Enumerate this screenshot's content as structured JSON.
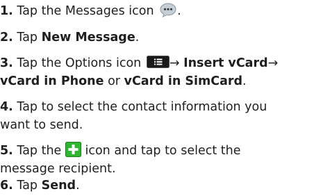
{
  "steps": [
    {
      "number": "1.",
      "text_before": "Tap the Messages icon",
      "icon": "messages-icon",
      "text_after": "."
    },
    {
      "number": "2.",
      "text_before": "Tap ",
      "bold": "New Message",
      "text_after": "."
    },
    {
      "number": "3.",
      "text_before": "Tap the Options icon",
      "icon": "options-icon",
      "arrow1": "→ ",
      "bold1": "Insert vCard",
      "arrow2": "→",
      "bold2": "vCard in Phone",
      "mid": " or ",
      "bold3": "vCard in SimCard",
      "text_after": "."
    },
    {
      "number": "4.",
      "line1": "Tap to select the contact information you",
      "line2": "want to send."
    },
    {
      "number": "5.",
      "text_before": "Tap the",
      "icon": "add-recipient-icon",
      "line1_after": "icon and tap to select the",
      "line2": "message recipient."
    },
    {
      "number": "6.",
      "text_before": "Tap ",
      "bold": "Send",
      "text_after": "."
    }
  ],
  "colors": {
    "text": "#1f1f1f",
    "messages_icon": "#c7cfd6",
    "options_icon": "#1a1a1a",
    "plus_icon_bg": "#2fb52f"
  }
}
